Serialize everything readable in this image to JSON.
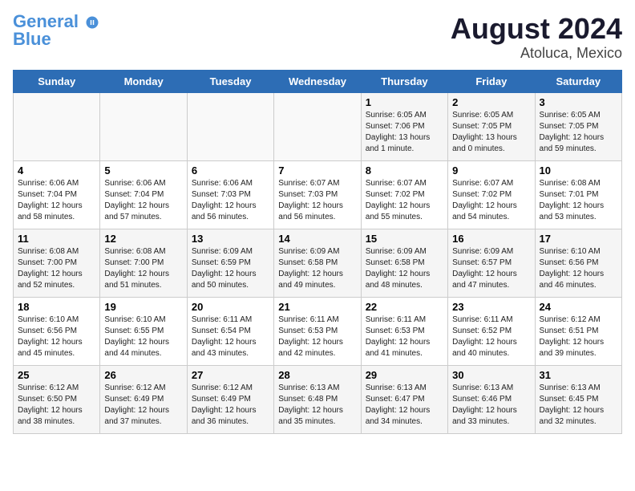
{
  "header": {
    "logo_line1": "General",
    "logo_line2": "Blue",
    "month_year": "August 2024",
    "location": "Atoluca, Mexico"
  },
  "weekdays": [
    "Sunday",
    "Monday",
    "Tuesday",
    "Wednesday",
    "Thursday",
    "Friday",
    "Saturday"
  ],
  "weeks": [
    [
      {
        "day": "",
        "info": ""
      },
      {
        "day": "",
        "info": ""
      },
      {
        "day": "",
        "info": ""
      },
      {
        "day": "",
        "info": ""
      },
      {
        "day": "1",
        "info": "Sunrise: 6:05 AM\nSunset: 7:06 PM\nDaylight: 13 hours\nand 1 minute."
      },
      {
        "day": "2",
        "info": "Sunrise: 6:05 AM\nSunset: 7:05 PM\nDaylight: 13 hours\nand 0 minutes."
      },
      {
        "day": "3",
        "info": "Sunrise: 6:05 AM\nSunset: 7:05 PM\nDaylight: 12 hours\nand 59 minutes."
      }
    ],
    [
      {
        "day": "4",
        "info": "Sunrise: 6:06 AM\nSunset: 7:04 PM\nDaylight: 12 hours\nand 58 minutes."
      },
      {
        "day": "5",
        "info": "Sunrise: 6:06 AM\nSunset: 7:04 PM\nDaylight: 12 hours\nand 57 minutes."
      },
      {
        "day": "6",
        "info": "Sunrise: 6:06 AM\nSunset: 7:03 PM\nDaylight: 12 hours\nand 56 minutes."
      },
      {
        "day": "7",
        "info": "Sunrise: 6:07 AM\nSunset: 7:03 PM\nDaylight: 12 hours\nand 56 minutes."
      },
      {
        "day": "8",
        "info": "Sunrise: 6:07 AM\nSunset: 7:02 PM\nDaylight: 12 hours\nand 55 minutes."
      },
      {
        "day": "9",
        "info": "Sunrise: 6:07 AM\nSunset: 7:02 PM\nDaylight: 12 hours\nand 54 minutes."
      },
      {
        "day": "10",
        "info": "Sunrise: 6:08 AM\nSunset: 7:01 PM\nDaylight: 12 hours\nand 53 minutes."
      }
    ],
    [
      {
        "day": "11",
        "info": "Sunrise: 6:08 AM\nSunset: 7:00 PM\nDaylight: 12 hours\nand 52 minutes."
      },
      {
        "day": "12",
        "info": "Sunrise: 6:08 AM\nSunset: 7:00 PM\nDaylight: 12 hours\nand 51 minutes."
      },
      {
        "day": "13",
        "info": "Sunrise: 6:09 AM\nSunset: 6:59 PM\nDaylight: 12 hours\nand 50 minutes."
      },
      {
        "day": "14",
        "info": "Sunrise: 6:09 AM\nSunset: 6:58 PM\nDaylight: 12 hours\nand 49 minutes."
      },
      {
        "day": "15",
        "info": "Sunrise: 6:09 AM\nSunset: 6:58 PM\nDaylight: 12 hours\nand 48 minutes."
      },
      {
        "day": "16",
        "info": "Sunrise: 6:09 AM\nSunset: 6:57 PM\nDaylight: 12 hours\nand 47 minutes."
      },
      {
        "day": "17",
        "info": "Sunrise: 6:10 AM\nSunset: 6:56 PM\nDaylight: 12 hours\nand 46 minutes."
      }
    ],
    [
      {
        "day": "18",
        "info": "Sunrise: 6:10 AM\nSunset: 6:56 PM\nDaylight: 12 hours\nand 45 minutes."
      },
      {
        "day": "19",
        "info": "Sunrise: 6:10 AM\nSunset: 6:55 PM\nDaylight: 12 hours\nand 44 minutes."
      },
      {
        "day": "20",
        "info": "Sunrise: 6:11 AM\nSunset: 6:54 PM\nDaylight: 12 hours\nand 43 minutes."
      },
      {
        "day": "21",
        "info": "Sunrise: 6:11 AM\nSunset: 6:53 PM\nDaylight: 12 hours\nand 42 minutes."
      },
      {
        "day": "22",
        "info": "Sunrise: 6:11 AM\nSunset: 6:53 PM\nDaylight: 12 hours\nand 41 minutes."
      },
      {
        "day": "23",
        "info": "Sunrise: 6:11 AM\nSunset: 6:52 PM\nDaylight: 12 hours\nand 40 minutes."
      },
      {
        "day": "24",
        "info": "Sunrise: 6:12 AM\nSunset: 6:51 PM\nDaylight: 12 hours\nand 39 minutes."
      }
    ],
    [
      {
        "day": "25",
        "info": "Sunrise: 6:12 AM\nSunset: 6:50 PM\nDaylight: 12 hours\nand 38 minutes."
      },
      {
        "day": "26",
        "info": "Sunrise: 6:12 AM\nSunset: 6:49 PM\nDaylight: 12 hours\nand 37 minutes."
      },
      {
        "day": "27",
        "info": "Sunrise: 6:12 AM\nSunset: 6:49 PM\nDaylight: 12 hours\nand 36 minutes."
      },
      {
        "day": "28",
        "info": "Sunrise: 6:13 AM\nSunset: 6:48 PM\nDaylight: 12 hours\nand 35 minutes."
      },
      {
        "day": "29",
        "info": "Sunrise: 6:13 AM\nSunset: 6:47 PM\nDaylight: 12 hours\nand 34 minutes."
      },
      {
        "day": "30",
        "info": "Sunrise: 6:13 AM\nSunset: 6:46 PM\nDaylight: 12 hours\nand 33 minutes."
      },
      {
        "day": "31",
        "info": "Sunrise: 6:13 AM\nSunset: 6:45 PM\nDaylight: 12 hours\nand 32 minutes."
      }
    ]
  ]
}
